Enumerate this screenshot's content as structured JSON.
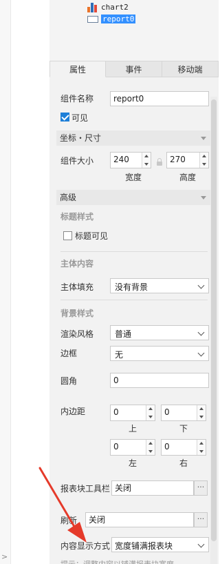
{
  "tree": {
    "items": [
      {
        "label": "chart2",
        "icon": "bar-chart-icon"
      },
      {
        "label": "report0",
        "icon": "report-block-icon",
        "selected": true
      }
    ]
  },
  "tabs": [
    {
      "label": "属性",
      "active": true
    },
    {
      "label": "事件",
      "active": false
    },
    {
      "label": "移动端",
      "active": false
    }
  ],
  "component_name": {
    "label": "组件名称",
    "value": "report0"
  },
  "visible": {
    "label": "可见",
    "checked": true
  },
  "section_coords": {
    "title": "坐标・尺寸"
  },
  "size": {
    "label": "组件大小",
    "width": {
      "value": "240",
      "label": "宽度"
    },
    "height": {
      "value": "270",
      "label": "高度"
    }
  },
  "section_advanced": {
    "title": "高级"
  },
  "title_style": {
    "group": "标题样式",
    "title_visible": {
      "label": "标题可见",
      "checked": false
    }
  },
  "body_content": {
    "group": "主体内容",
    "fill": {
      "label": "主体填充",
      "value": "没有背景"
    }
  },
  "background_style": {
    "group": "背景样式",
    "render_style": {
      "label": "渲染风格",
      "value": "普通"
    },
    "border": {
      "label": "边框",
      "value": "无"
    },
    "radius": {
      "label": "圆角",
      "value": "0"
    }
  },
  "padding": {
    "label": "内边距",
    "top": {
      "value": "0",
      "label": "上"
    },
    "bottom": {
      "value": "0",
      "label": "下"
    },
    "left": {
      "value": "0",
      "label": "左"
    },
    "right": {
      "value": "0",
      "label": "右"
    }
  },
  "toolbar": {
    "label": "报表块工具栏",
    "value": "关闭",
    "button": "···"
  },
  "refresh": {
    "label": "刷新",
    "value": "关闭",
    "button": "···"
  },
  "display_mode": {
    "label": "内容显示方式",
    "value": "宽度铺满报表块"
  },
  "hint": {
    "text": "提示：调整内容以铺满报表块宽度"
  },
  "colors": {
    "accent": "#1e7fd8",
    "selection": "#3390ff",
    "annotation_arrow": "#e53a2a"
  }
}
